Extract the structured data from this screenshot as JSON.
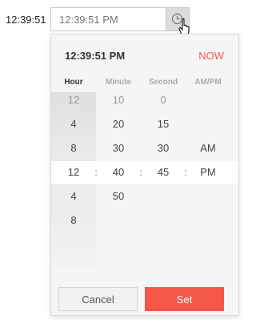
{
  "outside_label": "12:39:51",
  "input": {
    "value": "12:39:51 PM"
  },
  "picker": {
    "header_time": "12:39:51 PM",
    "now_label": "NOW",
    "columns": [
      "Hour",
      "Minute",
      "Second",
      "AM/PM"
    ],
    "active_column": "Hour",
    "hours_above": [
      "12",
      "4",
      "8"
    ],
    "minutes_above": [
      "10",
      "20",
      "30"
    ],
    "seconds_above": [
      "0",
      "15",
      "30"
    ],
    "ampm_above": [
      "",
      "",
      "AM"
    ],
    "selected": {
      "hour": "12",
      "minute": "40",
      "second": "45",
      "ampm": "PM"
    },
    "separator": ":",
    "hours_below": [
      "4",
      "8"
    ],
    "minutes_below": [
      "50"
    ],
    "cancel_label": "Cancel",
    "set_label": "Set"
  },
  "colors": {
    "accent": "#f4574a",
    "now": "#f05a4f"
  }
}
